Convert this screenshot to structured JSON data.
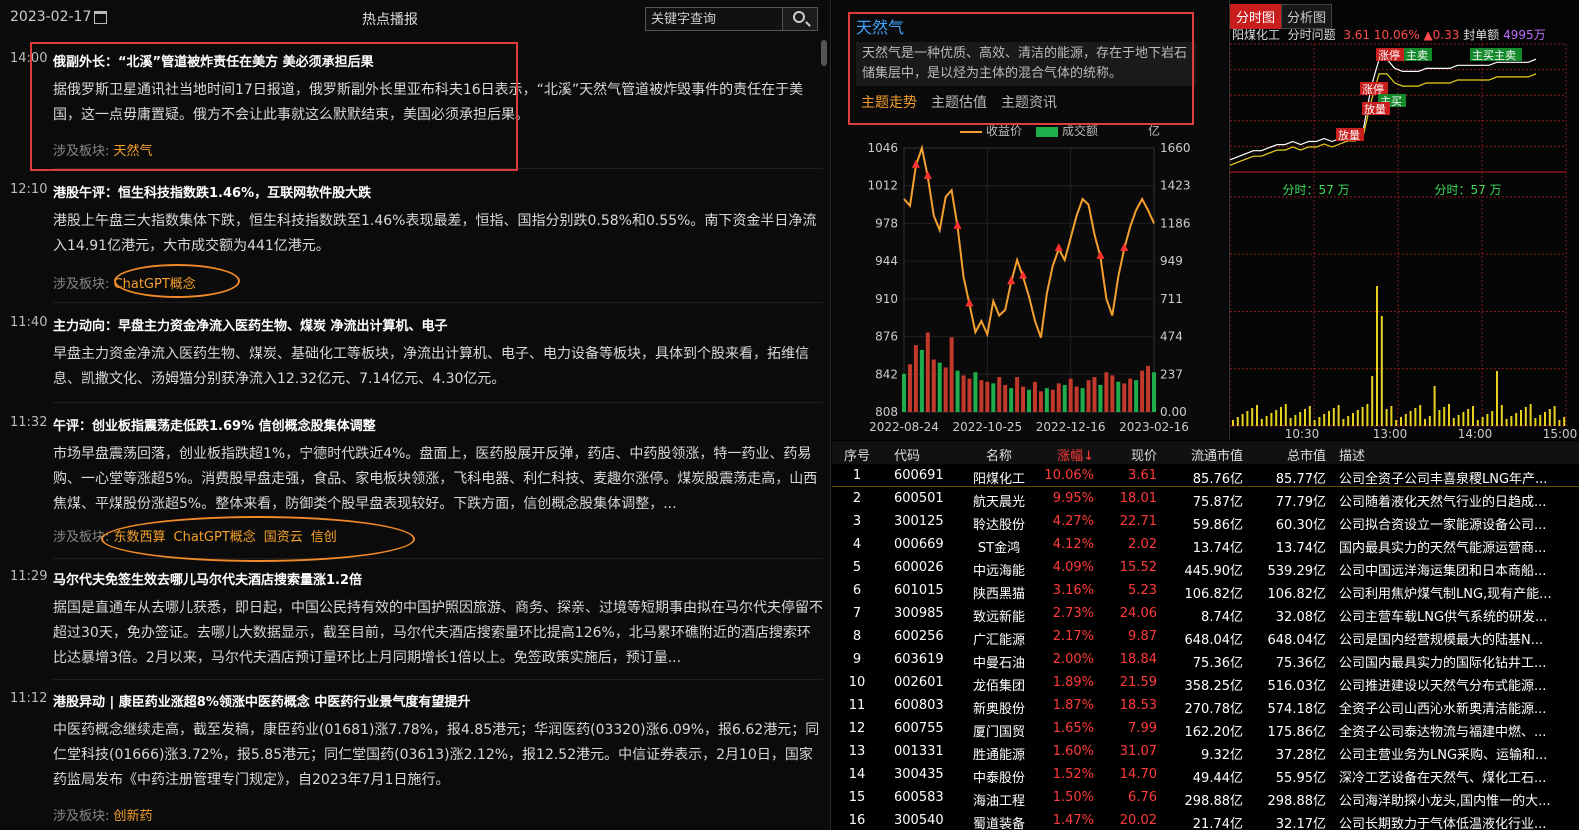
{
  "news": {
    "date": "2023-02-17",
    "title": "热点播报",
    "search_placeholder": "关键字查询",
    "sector_label": "涉及板块:",
    "items": [
      {
        "time": "14:00",
        "headline": "俄副外长：“北溪”管道被炸责任在美方 美必须承担后果",
        "body": "据俄罗斯卫星通讯社当地时间17日报道，俄罗斯副外长里亚布科夫16日表示，“北溪”天然气管道被炸毁事件的责任在于美国，这一点毋庸置疑。俄方不会让此事就这么默默结束，美国必须承担后果。",
        "tags": [
          "天然气"
        ]
      },
      {
        "time": "12:10",
        "headline": "港股午评：恒生科技指数跌1.46%，互联网软件股大跌",
        "body": "港股上午盘三大指数集体下跌，恒生科技指数跌至1.46%表现最差，恒指、国指分别跌0.58%和0.55%。南下资金半日净流入14.91亿港元，大市成交额为441亿港元。",
        "tags": [
          "ChatGPT概念"
        ]
      },
      {
        "time": "11:40",
        "headline": "主力动向：早盘主力资金净流入医药生物、煤炭 净流出计算机、电子",
        "body": "早盘主力资金净流入医药生物、煤炭、基础化工等板块，净流出计算机、电子、电力设备等板块，具体到个股来看，拓维信息、凯撒文化、汤姆猫分别获净流入12.32亿元、7.14亿元、4.30亿元。",
        "tags": []
      },
      {
        "time": "11:32",
        "headline": "午评：创业板指震荡走低跌1.69% 信创概念股集体调整",
        "body": "市场早盘震荡回落，创业板指跌超1%，宁德时代跌近4%。盘面上，医药股展开反弹，药店、中药股领涨，特一药业、药易购、一心堂等涨超5%。消费股早盘走强，食品、家电板块领涨，飞科电器、利仁科技、麦趣尔涨停。煤炭股震荡走高，山西焦煤、平煤股份涨超5%。整体来看，防御类个股早盘表现较好。下跌方面，信创概念股集体调整，...",
        "tags": [
          "东数西算",
          "ChatGPT概念",
          "国资云",
          "信创"
        ]
      },
      {
        "time": "11:29",
        "headline": "马尔代夫免签生效去哪儿马尔代夫酒店搜索量涨1.2倍",
        "body": "据国是直通车从去哪儿获悉，即日起，中国公民持有效的中国护照因旅游、商务、探亲、过境等短期事由拟在马尔代夫停留不超过30天，免办签证。去哪儿大数据显示，截至目前，马尔代夫酒店搜索量环比提高126%，北马累环礁附近的酒店搜索环比达暴增3倍。2月以来，马尔代夫酒店预订量环比上月同期增长1倍以上。免签政策实施后，预订量...",
        "tags": []
      },
      {
        "time": "11:12",
        "headline": "港股异动 | 康臣药业涨超8%领涨中医药概念 中医药行业景气度有望提升",
        "body": "中医药概念继续走高，截至发稿，康臣药业(01681)涨7.78%，报4.85港元；华润医药(03320)涨6.09%，报6.62港元；同仁堂科技(01666)涨3.72%，报5.85港元；同仁堂国药(03613)涨2.12%，报12.52港元。中信证券表示，2月10日，国家药监局发布《中药注册管理专门规定》，自2023年7月1日施行。",
        "tags": [
          "创新药"
        ]
      }
    ]
  },
  "theme": {
    "name": "天然气",
    "description": "天然气是一种优质、高效、清洁的能源，存在于地下岩石储集层中，是以烃为主体的混合气体的统称。",
    "tabs": [
      "主题走势",
      "主题估值",
      "主题资讯"
    ],
    "active_tab": "主题走势",
    "legend_line": "收益价",
    "legend_bar": "成交额",
    "unit": "亿",
    "line_color": "#f4a02e",
    "bar_color": "#1fae4c"
  },
  "chart_data": [
    {
      "type": "line",
      "title": "",
      "series": [
        {
          "name": "收益价",
          "values": [
            1000,
            994,
            1030,
            1046,
            1020,
            985,
            972,
            1002,
            1008,
            975,
            930,
            905,
            880,
            890,
            878,
            908,
            895,
            900,
            925,
            945,
            930,
            912,
            890,
            875,
            915,
            940,
            955,
            945,
            965,
            985,
            1000,
            995,
            968,
            948,
            910,
            895,
            930,
            955,
            975,
            990,
            1000,
            990,
            978
          ]
        },
        {
          "name": "成交额",
          "values": [
            240,
            300,
            420,
            390,
            500,
            330,
            310,
            280,
            470,
            260,
            230,
            210,
            250,
            200,
            190,
            180,
            220,
            170,
            150,
            220,
            160,
            140,
            190,
            130,
            150,
            140,
            180,
            170,
            210,
            160,
            150,
            200,
            220,
            170,
            250,
            230,
            190,
            180,
            210,
            200,
            260,
            290,
            250
          ]
        }
      ],
      "x_tick_labels": [
        "2022-08-24",
        "2022-10-25",
        "2022-12-16",
        "2023-02-16"
      ],
      "y_left_ticks": [
        808,
        842,
        876,
        910,
        944,
        978,
        1012,
        1046
      ],
      "y_right_ticks": [
        "0.00",
        "237",
        "474",
        "711",
        "949",
        "1186",
        "1423",
        "1660"
      ],
      "ylim_left": [
        808,
        1046
      ],
      "ylim_right": [
        0,
        1660
      ],
      "grid": true
    },
    {
      "type": "line",
      "title": "",
      "series": [
        {
          "name": "分时",
          "values": [
            3.28,
            3.29,
            3.3,
            3.31,
            3.31,
            3.32,
            3.33,
            3.33,
            3.34,
            3.33,
            3.34,
            3.34,
            3.35,
            3.34,
            3.35,
            3.36,
            3.36,
            3.38,
            3.52,
            3.61,
            3.61,
            3.58,
            3.57,
            3.57,
            3.57,
            3.58,
            3.58,
            3.58,
            3.58,
            3.59,
            3.59,
            3.59,
            3.59,
            3.59,
            3.6,
            3.6,
            3.6,
            3.6,
            3.6,
            3.61
          ]
        }
      ],
      "x_tick_labels": [
        "10:30",
        "13:00",
        "14:00",
        "15:00"
      ],
      "annotations": [
        "涨停",
        "主卖",
        "主卖",
        "主买主卖",
        "涨停",
        "主买",
        "放量",
        "放量"
      ],
      "volume_label": "分时：57 万",
      "grid": true
    }
  ],
  "intraday": {
    "tabs": [
      "分时图",
      "分析图"
    ],
    "stock_name": "阳煤化工",
    "label": "分时问题",
    "price": "3.61",
    "pct": "10.06%",
    "change": "▲0.33",
    "seal_label": "封单额",
    "seal_amount": "4995万",
    "volume_label": "分时：57 万"
  },
  "table": {
    "headers": [
      "序号",
      "代码",
      "名称",
      "涨幅↓",
      "现价",
      "流通市值",
      "总市值",
      "描述"
    ],
    "rows": [
      [
        "1",
        "600691",
        "阳煤化工",
        "10.06%",
        "3.61",
        "85.76亿",
        "85.77亿",
        "公司全资子公司丰喜泉稷LNG年产..."
      ],
      [
        "2",
        "600501",
        "航天晨光",
        "9.95%",
        "18.01",
        "75.87亿",
        "77.79亿",
        "公司随着液化天然气行业的日趋成..."
      ],
      [
        "3",
        "300125",
        "聆达股份",
        "4.27%",
        "22.71",
        "59.86亿",
        "60.30亿",
        "公司拟合资设立一家能源设备公司..."
      ],
      [
        "4",
        "000669",
        "ST金鸿",
        "4.12%",
        "2.02",
        "13.74亿",
        "13.74亿",
        "国内最具实力的天然气能源运营商..."
      ],
      [
        "5",
        "600026",
        "中远海能",
        "4.09%",
        "15.52",
        "445.90亿",
        "539.29亿",
        "公司中国远洋海运集团和日本商船..."
      ],
      [
        "6",
        "601015",
        "陕西黑猫",
        "3.16%",
        "5.23",
        "106.82亿",
        "106.82亿",
        "公司利用焦炉煤气制LNG,现有产能..."
      ],
      [
        "7",
        "300985",
        "致远新能",
        "2.73%",
        "24.06",
        "8.74亿",
        "32.08亿",
        "公司主营车载LNG供气系统的研发..."
      ],
      [
        "8",
        "600256",
        "广汇能源",
        "2.17%",
        "9.87",
        "648.04亿",
        "648.04亿",
        "公司是国内经营规模最大的陆基N..."
      ],
      [
        "9",
        "603619",
        "中曼石油",
        "2.00%",
        "18.84",
        "75.36亿",
        "75.36亿",
        "公司国内最具实力的国际化钻井工..."
      ],
      [
        "10",
        "002601",
        "龙佰集团",
        "1.89%",
        "21.59",
        "358.25亿",
        "516.03亿",
        "公司推进建设以天然气分布式能源..."
      ],
      [
        "11",
        "600803",
        "新奥股份",
        "1.87%",
        "18.53",
        "270.78亿",
        "574.18亿",
        "全资子公司山西沁水新奥清洁能源..."
      ],
      [
        "12",
        "600755",
        "厦门国贸",
        "1.65%",
        "7.99",
        "162.20亿",
        "175.86亿",
        "全资子公司泰达物流与福建中燃、..."
      ],
      [
        "13",
        "001331",
        "胜通能源",
        "1.60%",
        "31.07",
        "9.32亿",
        "37.28亿",
        "公司主营业务为LNG采购、运输和..."
      ],
      [
        "14",
        "300435",
        "中泰股份",
        "1.52%",
        "14.70",
        "49.44亿",
        "55.95亿",
        "深冷工艺设备在天然气、煤化工石..."
      ],
      [
        "15",
        "600583",
        "海油工程",
        "1.50%",
        "6.76",
        "298.88亿",
        "298.88亿",
        "公司海洋助探小龙头,国内惟一的大..."
      ],
      [
        "16",
        "300540",
        "蜀道装备",
        "1.47%",
        "20.02",
        "21.74亿",
        "32.17亿",
        "公司长期致力于气体低温液化行业..."
      ]
    ]
  }
}
